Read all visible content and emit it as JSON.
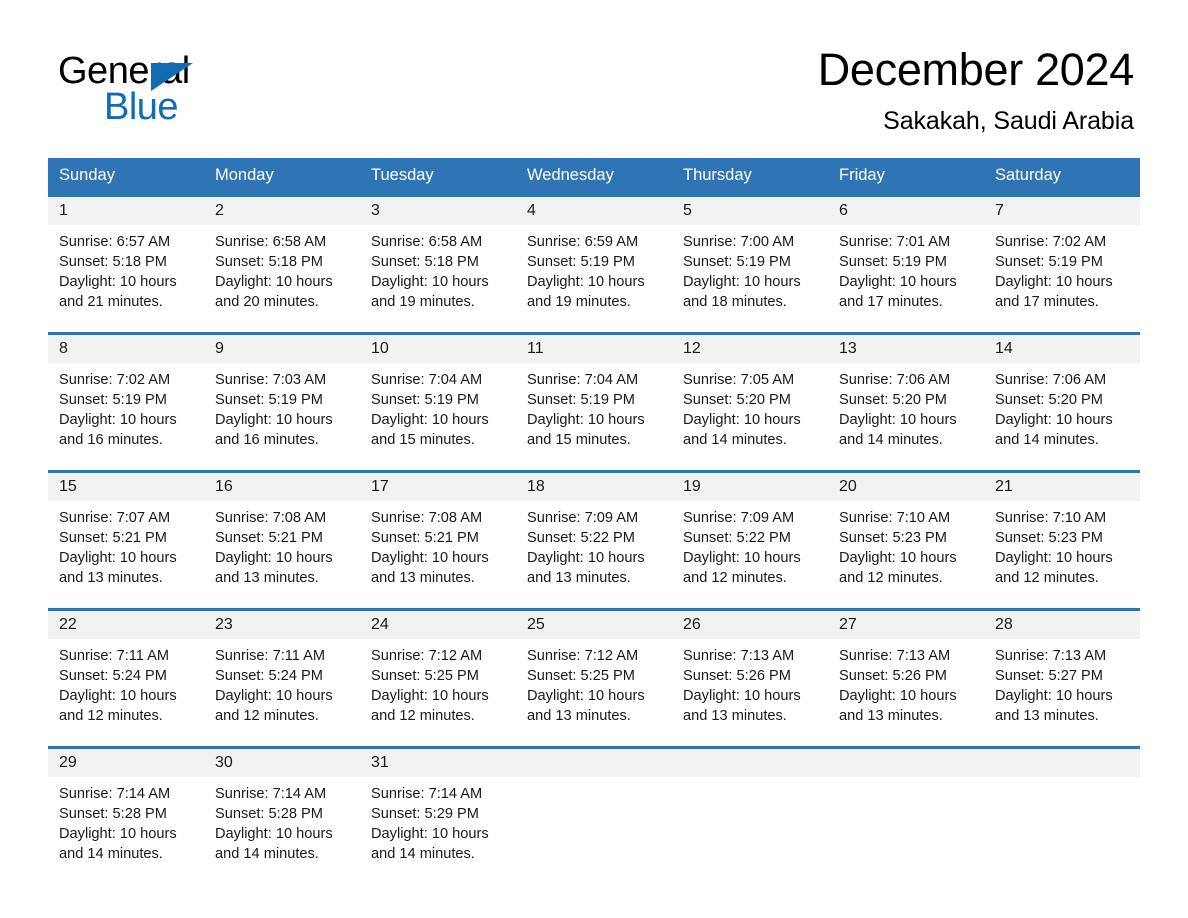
{
  "brand": {
    "name_part1": "General",
    "name_part2": "Blue",
    "accent_color": "#0f6cb5"
  },
  "header": {
    "month_title": "December 2024",
    "location": "Sakakah, Saudi Arabia",
    "header_bg_color": "#2f75b5",
    "daynum_bg_color": "#f2f2f2"
  },
  "weekday_headers": [
    "Sunday",
    "Monday",
    "Tuesday",
    "Wednesday",
    "Thursday",
    "Friday",
    "Saturday"
  ],
  "weeks": [
    [
      {
        "day": "1",
        "sunrise": "Sunrise: 6:57 AM",
        "sunset": "Sunset: 5:18 PM",
        "daylight": "Daylight: 10 hours and 21 minutes."
      },
      {
        "day": "2",
        "sunrise": "Sunrise: 6:58 AM",
        "sunset": "Sunset: 5:18 PM",
        "daylight": "Daylight: 10 hours and 20 minutes."
      },
      {
        "day": "3",
        "sunrise": "Sunrise: 6:58 AM",
        "sunset": "Sunset: 5:18 PM",
        "daylight": "Daylight: 10 hours and 19 minutes."
      },
      {
        "day": "4",
        "sunrise": "Sunrise: 6:59 AM",
        "sunset": "Sunset: 5:19 PM",
        "daylight": "Daylight: 10 hours and 19 minutes."
      },
      {
        "day": "5",
        "sunrise": "Sunrise: 7:00 AM",
        "sunset": "Sunset: 5:19 PM",
        "daylight": "Daylight: 10 hours and 18 minutes."
      },
      {
        "day": "6",
        "sunrise": "Sunrise: 7:01 AM",
        "sunset": "Sunset: 5:19 PM",
        "daylight": "Daylight: 10 hours and 17 minutes."
      },
      {
        "day": "7",
        "sunrise": "Sunrise: 7:02 AM",
        "sunset": "Sunset: 5:19 PM",
        "daylight": "Daylight: 10 hours and 17 minutes."
      }
    ],
    [
      {
        "day": "8",
        "sunrise": "Sunrise: 7:02 AM",
        "sunset": "Sunset: 5:19 PM",
        "daylight": "Daylight: 10 hours and 16 minutes."
      },
      {
        "day": "9",
        "sunrise": "Sunrise: 7:03 AM",
        "sunset": "Sunset: 5:19 PM",
        "daylight": "Daylight: 10 hours and 16 minutes."
      },
      {
        "day": "10",
        "sunrise": "Sunrise: 7:04 AM",
        "sunset": "Sunset: 5:19 PM",
        "daylight": "Daylight: 10 hours and 15 minutes."
      },
      {
        "day": "11",
        "sunrise": "Sunrise: 7:04 AM",
        "sunset": "Sunset: 5:19 PM",
        "daylight": "Daylight: 10 hours and 15 minutes."
      },
      {
        "day": "12",
        "sunrise": "Sunrise: 7:05 AM",
        "sunset": "Sunset: 5:20 PM",
        "daylight": "Daylight: 10 hours and 14 minutes."
      },
      {
        "day": "13",
        "sunrise": "Sunrise: 7:06 AM",
        "sunset": "Sunset: 5:20 PM",
        "daylight": "Daylight: 10 hours and 14 minutes."
      },
      {
        "day": "14",
        "sunrise": "Sunrise: 7:06 AM",
        "sunset": "Sunset: 5:20 PM",
        "daylight": "Daylight: 10 hours and 14 minutes."
      }
    ],
    [
      {
        "day": "15",
        "sunrise": "Sunrise: 7:07 AM",
        "sunset": "Sunset: 5:21 PM",
        "daylight": "Daylight: 10 hours and 13 minutes."
      },
      {
        "day": "16",
        "sunrise": "Sunrise: 7:08 AM",
        "sunset": "Sunset: 5:21 PM",
        "daylight": "Daylight: 10 hours and 13 minutes."
      },
      {
        "day": "17",
        "sunrise": "Sunrise: 7:08 AM",
        "sunset": "Sunset: 5:21 PM",
        "daylight": "Daylight: 10 hours and 13 minutes."
      },
      {
        "day": "18",
        "sunrise": "Sunrise: 7:09 AM",
        "sunset": "Sunset: 5:22 PM",
        "daylight": "Daylight: 10 hours and 13 minutes."
      },
      {
        "day": "19",
        "sunrise": "Sunrise: 7:09 AM",
        "sunset": "Sunset: 5:22 PM",
        "daylight": "Daylight: 10 hours and 12 minutes."
      },
      {
        "day": "20",
        "sunrise": "Sunrise: 7:10 AM",
        "sunset": "Sunset: 5:23 PM",
        "daylight": "Daylight: 10 hours and 12 minutes."
      },
      {
        "day": "21",
        "sunrise": "Sunrise: 7:10 AM",
        "sunset": "Sunset: 5:23 PM",
        "daylight": "Daylight: 10 hours and 12 minutes."
      }
    ],
    [
      {
        "day": "22",
        "sunrise": "Sunrise: 7:11 AM",
        "sunset": "Sunset: 5:24 PM",
        "daylight": "Daylight: 10 hours and 12 minutes."
      },
      {
        "day": "23",
        "sunrise": "Sunrise: 7:11 AM",
        "sunset": "Sunset: 5:24 PM",
        "daylight": "Daylight: 10 hours and 12 minutes."
      },
      {
        "day": "24",
        "sunrise": "Sunrise: 7:12 AM",
        "sunset": "Sunset: 5:25 PM",
        "daylight": "Daylight: 10 hours and 12 minutes."
      },
      {
        "day": "25",
        "sunrise": "Sunrise: 7:12 AM",
        "sunset": "Sunset: 5:25 PM",
        "daylight": "Daylight: 10 hours and 13 minutes."
      },
      {
        "day": "26",
        "sunrise": "Sunrise: 7:13 AM",
        "sunset": "Sunset: 5:26 PM",
        "daylight": "Daylight: 10 hours and 13 minutes."
      },
      {
        "day": "27",
        "sunrise": "Sunrise: 7:13 AM",
        "sunset": "Sunset: 5:26 PM",
        "daylight": "Daylight: 10 hours and 13 minutes."
      },
      {
        "day": "28",
        "sunrise": "Sunrise: 7:13 AM",
        "sunset": "Sunset: 5:27 PM",
        "daylight": "Daylight: 10 hours and 13 minutes."
      }
    ],
    [
      {
        "day": "29",
        "sunrise": "Sunrise: 7:14 AM",
        "sunset": "Sunset: 5:28 PM",
        "daylight": "Daylight: 10 hours and 14 minutes."
      },
      {
        "day": "30",
        "sunrise": "Sunrise: 7:14 AM",
        "sunset": "Sunset: 5:28 PM",
        "daylight": "Daylight: 10 hours and 14 minutes."
      },
      {
        "day": "31",
        "sunrise": "Sunrise: 7:14 AM",
        "sunset": "Sunset: 5:29 PM",
        "daylight": "Daylight: 10 hours and 14 minutes."
      },
      {
        "day": "",
        "sunrise": "",
        "sunset": "",
        "daylight": ""
      },
      {
        "day": "",
        "sunrise": "",
        "sunset": "",
        "daylight": ""
      },
      {
        "day": "",
        "sunrise": "",
        "sunset": "",
        "daylight": ""
      },
      {
        "day": "",
        "sunrise": "",
        "sunset": "",
        "daylight": ""
      }
    ]
  ]
}
